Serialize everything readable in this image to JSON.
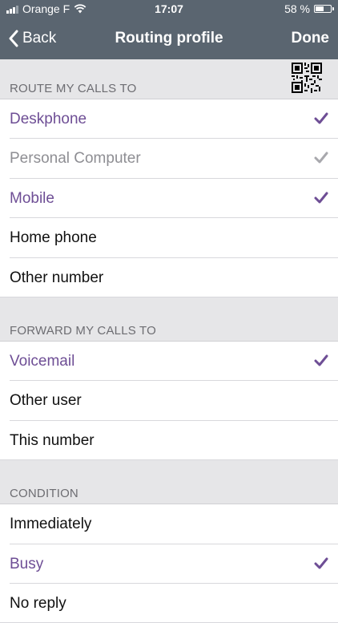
{
  "status": {
    "carrier": "Orange F",
    "time": "17:07",
    "battery": "58 %",
    "battery_level": 0.58
  },
  "nav": {
    "back_label": "Back",
    "title": "Routing profile",
    "done_label": "Done"
  },
  "sections": {
    "route": {
      "header": "ROUTE MY CALLS TO",
      "items": [
        {
          "label": "Deskphone",
          "state": "selected"
        },
        {
          "label": "Personal Computer",
          "state": "disabled-checked"
        },
        {
          "label": "Mobile",
          "state": "selected"
        },
        {
          "label": "Home phone",
          "state": "none"
        },
        {
          "label": "Other number",
          "state": "none"
        }
      ]
    },
    "forward": {
      "header": "FORWARD MY CALLS TO",
      "items": [
        {
          "label": "Voicemail",
          "state": "selected"
        },
        {
          "label": "Other user",
          "state": "none"
        },
        {
          "label": "This number",
          "state": "none"
        }
      ]
    },
    "condition": {
      "header": "CONDITION",
      "items": [
        {
          "label": "Immediately",
          "state": "none"
        },
        {
          "label": "Busy",
          "state": "selected"
        },
        {
          "label": "No reply",
          "state": "none"
        }
      ]
    }
  },
  "colors": {
    "accent": "#6e4e95",
    "disabled": "#8e8e93",
    "header_bg": "#5a6570"
  },
  "icons": {
    "back": "chevron-left-icon",
    "check": "checkmark-icon",
    "qr": "qr-code-icon",
    "wifi": "wifi-icon",
    "battery": "battery-icon"
  }
}
